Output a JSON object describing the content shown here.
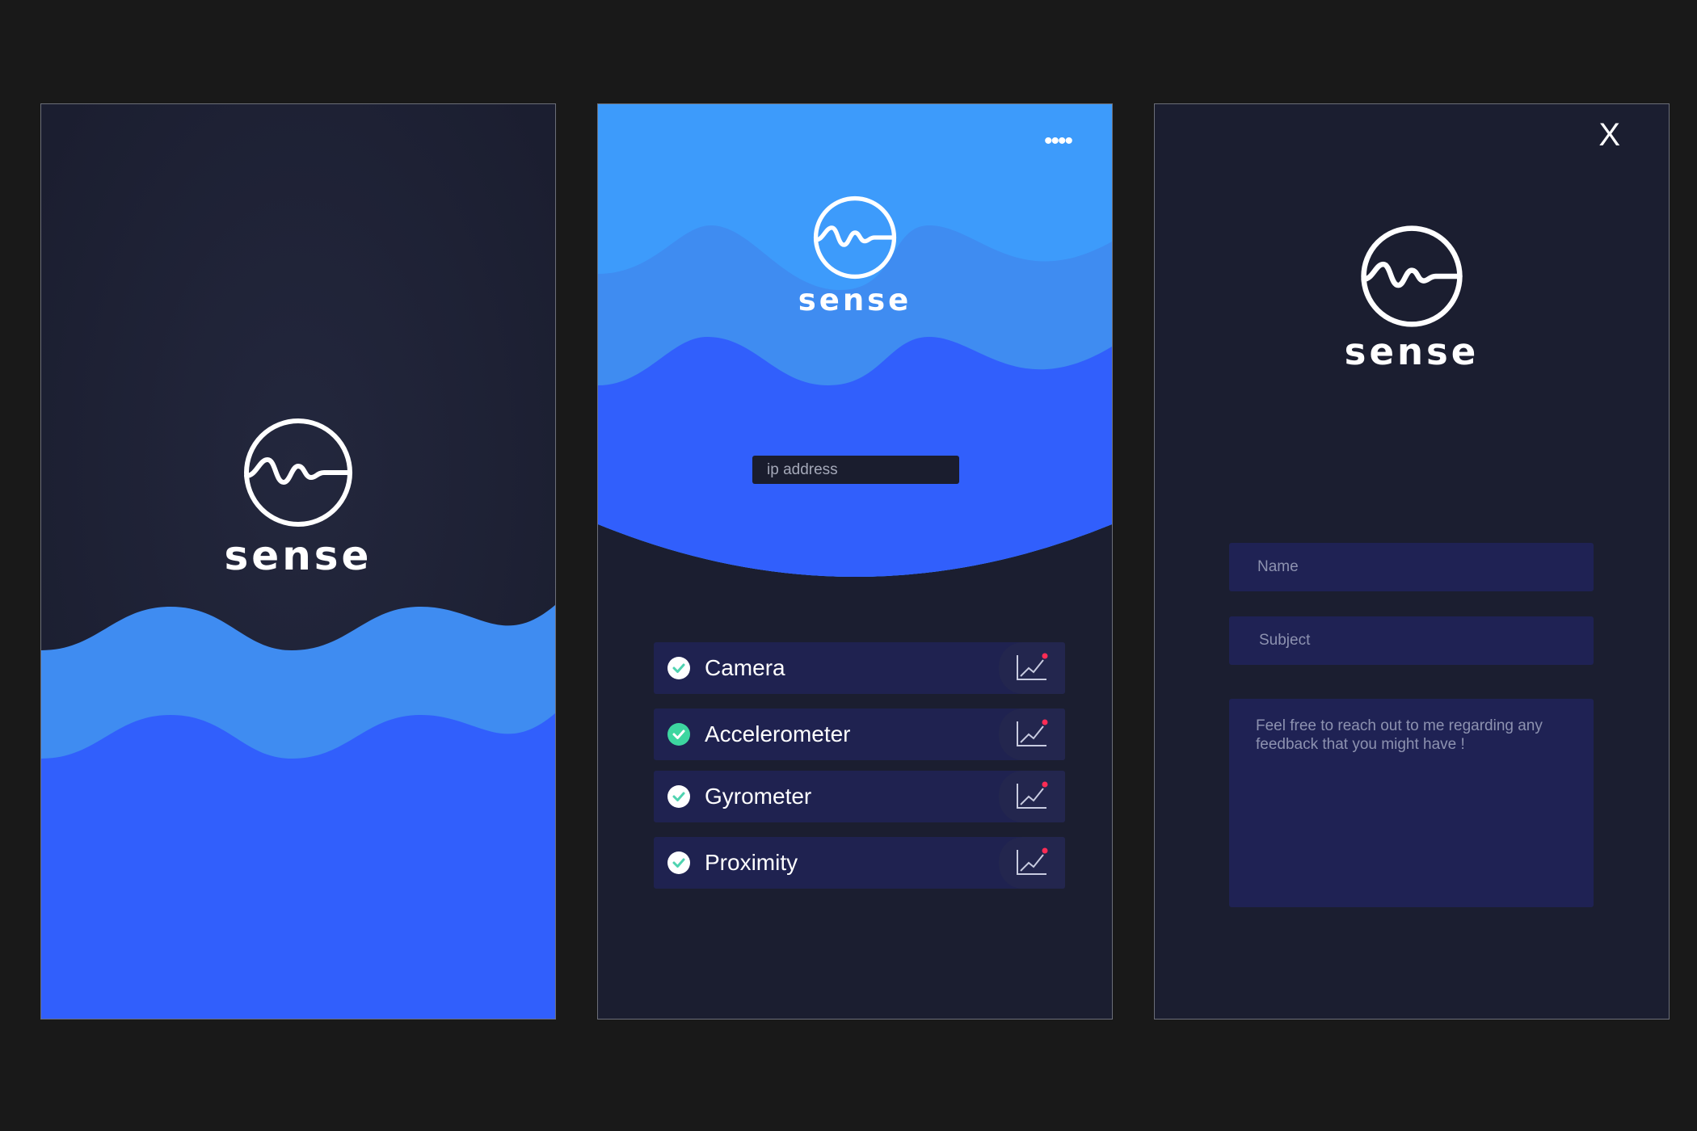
{
  "app": {
    "brand": "sense"
  },
  "screen_splash": {
    "brand": "sense"
  },
  "screen_main": {
    "brand": "sense",
    "menu_icon": "more-dots-icon",
    "ip_placeholder": "ip address",
    "sensors": [
      {
        "label": "Camera",
        "checked": true,
        "check_color": "#ffffff"
      },
      {
        "label": "Accelerometer",
        "checked": true,
        "check_color": "#3dd6a0"
      },
      {
        "label": "Gyrometer",
        "checked": true,
        "check_color": "#ffffff"
      },
      {
        "label": "Proximity",
        "checked": true,
        "check_color": "#ffffff"
      }
    ]
  },
  "screen_feedback": {
    "brand": "sense",
    "close_label": "X",
    "name_placeholder": "Name",
    "subject_placeholder": "Subject",
    "message_placeholder": "Feel free to reach out to me regarding any feedback that you might have !"
  },
  "colors": {
    "background": "#191919",
    "dark": "#1b1e30",
    "blue_light": "#3d9bfb",
    "blue_mid": "#3f8cf1",
    "blue_deep": "#315ffc",
    "field": "#1f2254",
    "accent_green": "#3dd6a0",
    "alert_red": "#ff2c55"
  }
}
